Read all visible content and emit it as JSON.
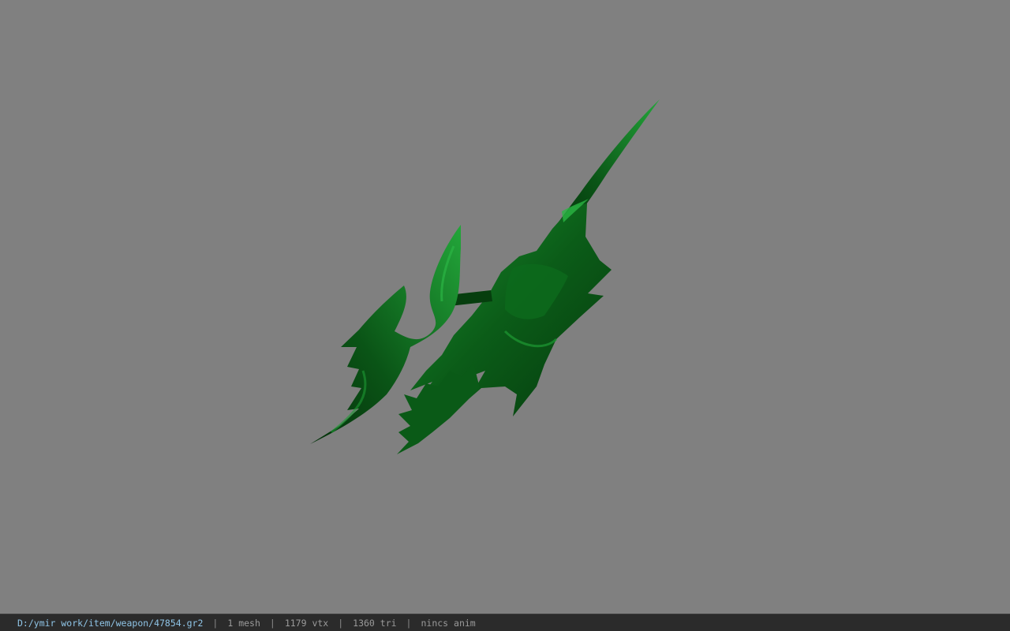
{
  "colors": {
    "background": "#808080",
    "statusbar_bg": "#2b2b2b",
    "path_text": "#8fc4e6",
    "info_text": "#9a9a9a",
    "model_dark": "#063d10",
    "model_mid": "#0d6a1c",
    "model_light": "#1e9a33"
  },
  "viewport": {
    "model_icon": "green-bladed-weapon-model"
  },
  "status": {
    "file_path": "D:/ymir work/item/weapon/47854.gr2",
    "separator": "|",
    "mesh": "1 mesh",
    "vertices": "1179 vtx",
    "triangles": "1360 tri",
    "animation": "nincs anim"
  }
}
